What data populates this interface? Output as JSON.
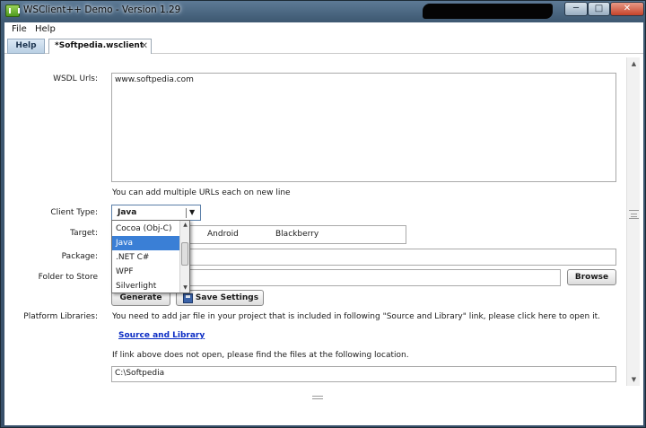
{
  "window": {
    "title": "WSClient++ Demo - Version 1.29",
    "min_label": "─",
    "max_label": "□",
    "close_label": "✕"
  },
  "menu": {
    "items": [
      "File",
      "Help"
    ]
  },
  "tabs": {
    "help": "Help",
    "file": "*Softpedia.wsclient",
    "close": "✕"
  },
  "form": {
    "wsdl_label": "WSDL Urls:",
    "wsdl_value": "www.softpedia.com",
    "wsdl_hint": "You can add multiple URLs each on new line",
    "client_type_label": "Client Type:",
    "client_type_value": "Java",
    "target_label": "Target:",
    "target_options": [
      "Android",
      "Blackberry"
    ],
    "package_label": "Package:",
    "package_value": "",
    "folder_label": "Folder to Store",
    "folder_value": "",
    "browse_label": "Browse",
    "generate_label": "Generate",
    "save_label": "Save Settings",
    "platform_label": "Platform Libraries:",
    "platform_text": "You need to add jar file in your project that is included in following \"Source and Library\" link, please click here to open it.",
    "source_link": "Source and Library",
    "fallback_text": "If link above does not open, please find the files at the following location.",
    "location_value": "C:\\Softpedia"
  },
  "dropdown": {
    "options": [
      "Cocoa (Obj-C)",
      "Java",
      ".NET C#",
      "WPF",
      "Silverlight"
    ],
    "selected": "Java"
  },
  "colors": {
    "accent": "#3a7fd6",
    "link": "#0b2cc4",
    "close": "#c4432a"
  }
}
